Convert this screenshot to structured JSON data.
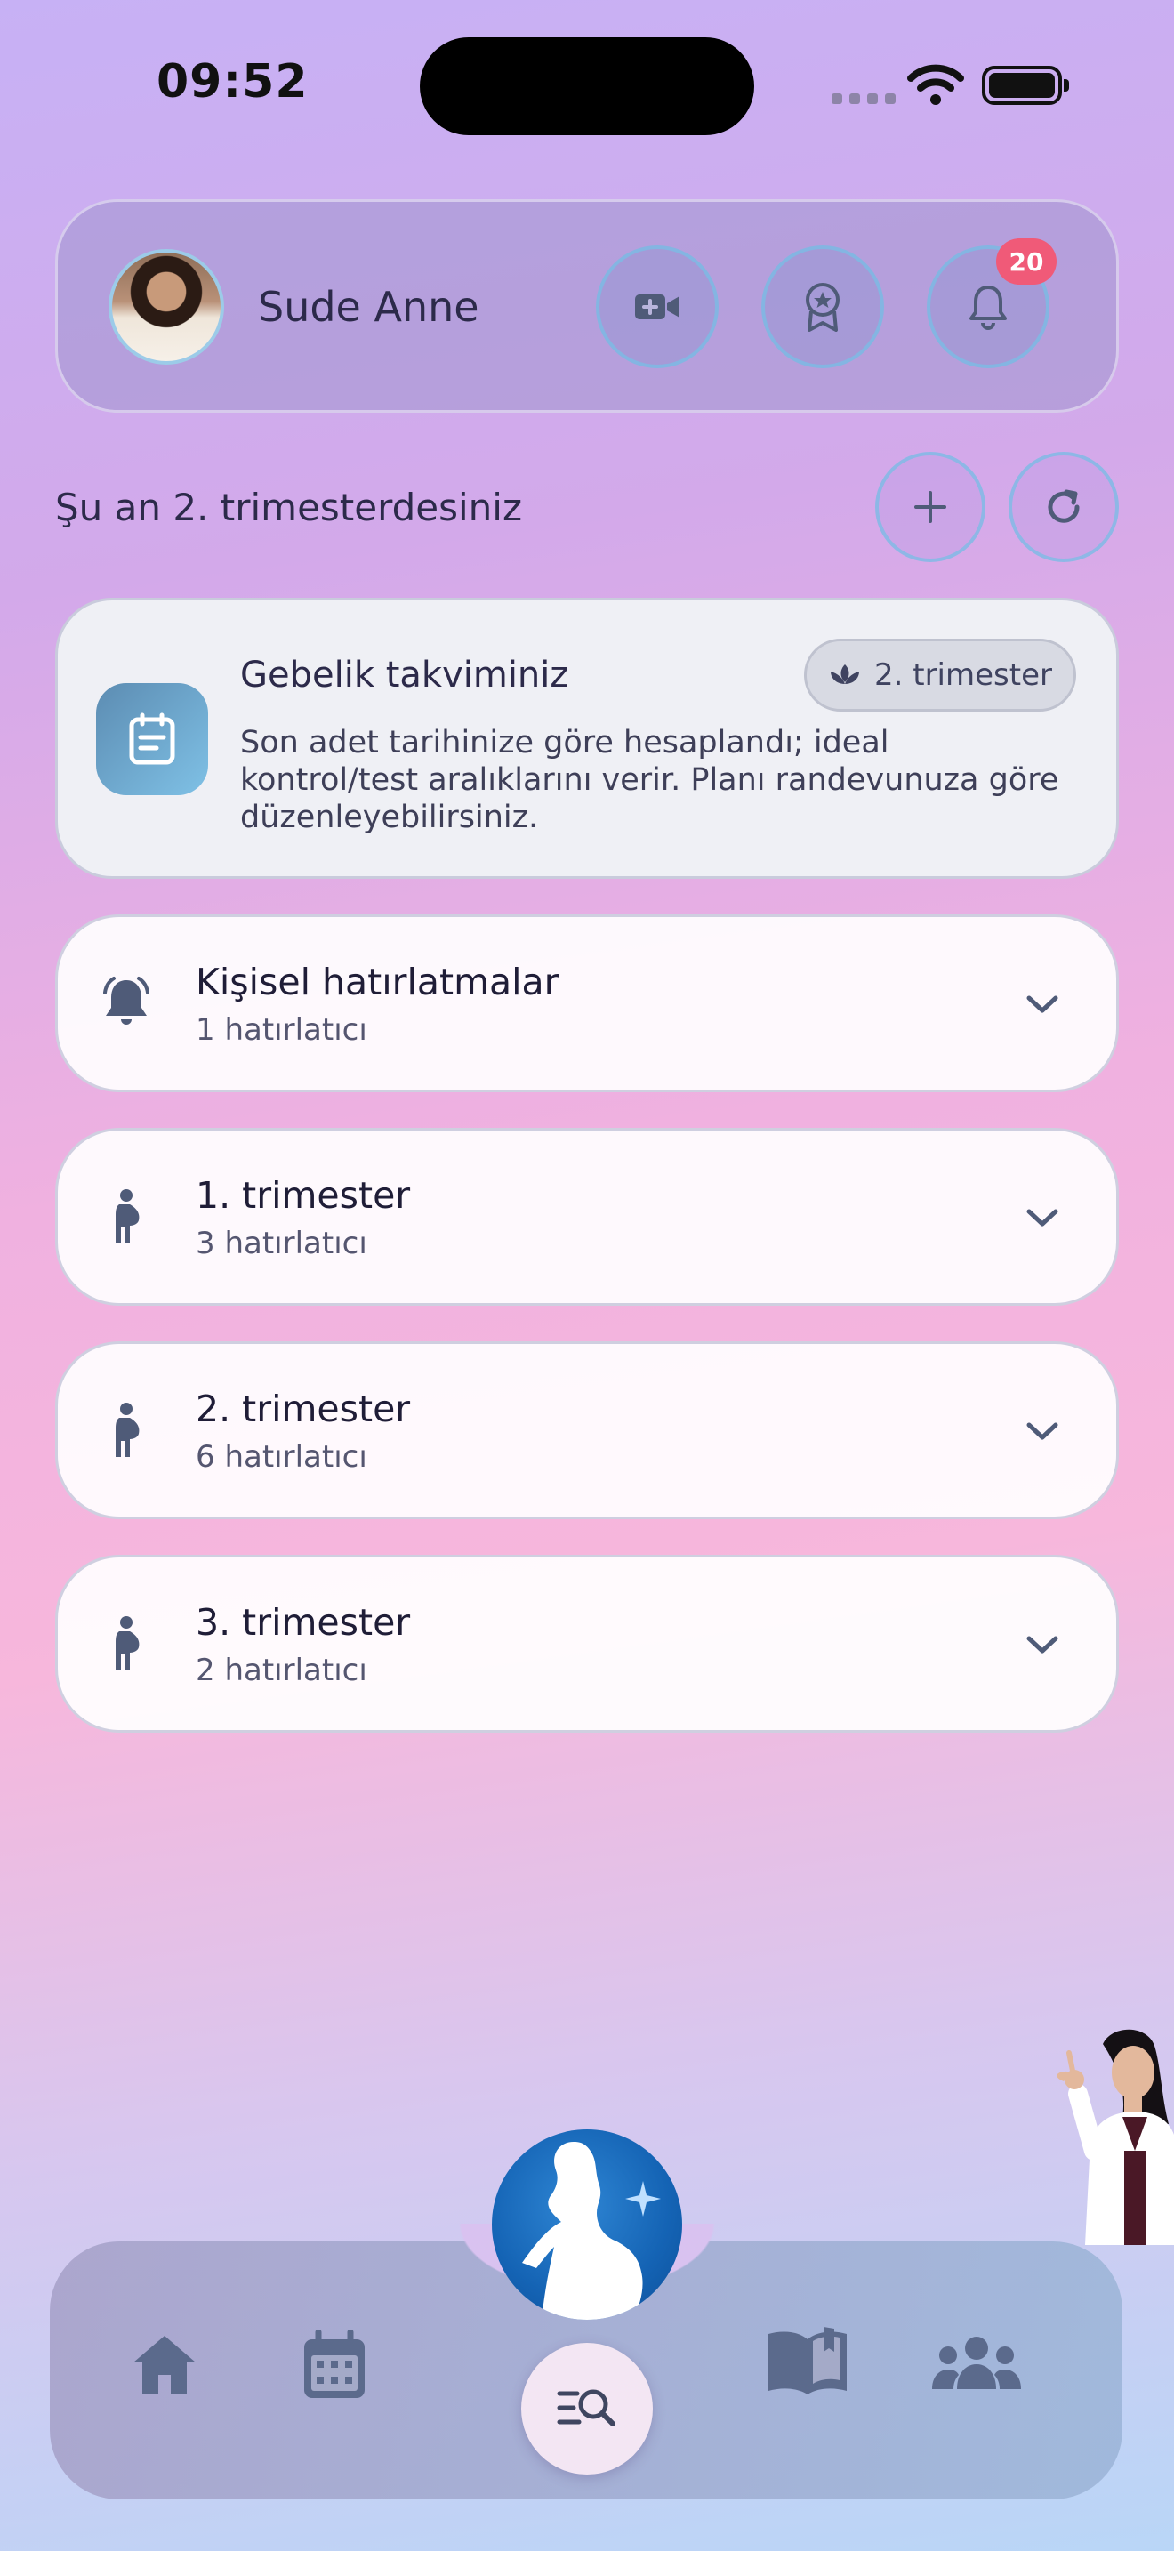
{
  "status_bar": {
    "time": "09:52"
  },
  "header": {
    "user_name": "Sude Anne",
    "notification_count": "20",
    "buttons": [
      "video-call",
      "achievements",
      "notifications"
    ]
  },
  "pregnancy": {
    "current_trimester_text": "Şu an 2. trimesterdesiniz"
  },
  "calendar_card": {
    "title": "Gebelik takviminiz",
    "chip_label": "2. trimester",
    "description": "Son adet tarihinize göre hesaplandı; ideal kontrol/test aralıklarını verir. Planı randevunuza göre düzenleyebilirsiniz."
  },
  "sections": [
    {
      "title": "Kişisel hatırlatmalar",
      "subtitle": "1 hatırlatıcı",
      "icon": "bell-icon"
    },
    {
      "title": "1. trimester",
      "subtitle": "3 hatırlatıcı",
      "icon": "pregnant-icon"
    },
    {
      "title": "2. trimester",
      "subtitle": "6 hatırlatıcı",
      "icon": "pregnant-icon"
    },
    {
      "title": "3. trimester",
      "subtitle": "2 hatırlatıcı",
      "icon": "pregnant-icon"
    }
  ],
  "bottom_nav": {
    "items": [
      "home-icon",
      "calendar-icon",
      "pregnancy-assistant",
      "search-icon",
      "book-icon",
      "community-icon"
    ]
  },
  "colors": {
    "accent_blue": "#1463b4",
    "badge_red": "#f05a78",
    "icon_slate": "#4f5b78"
  }
}
